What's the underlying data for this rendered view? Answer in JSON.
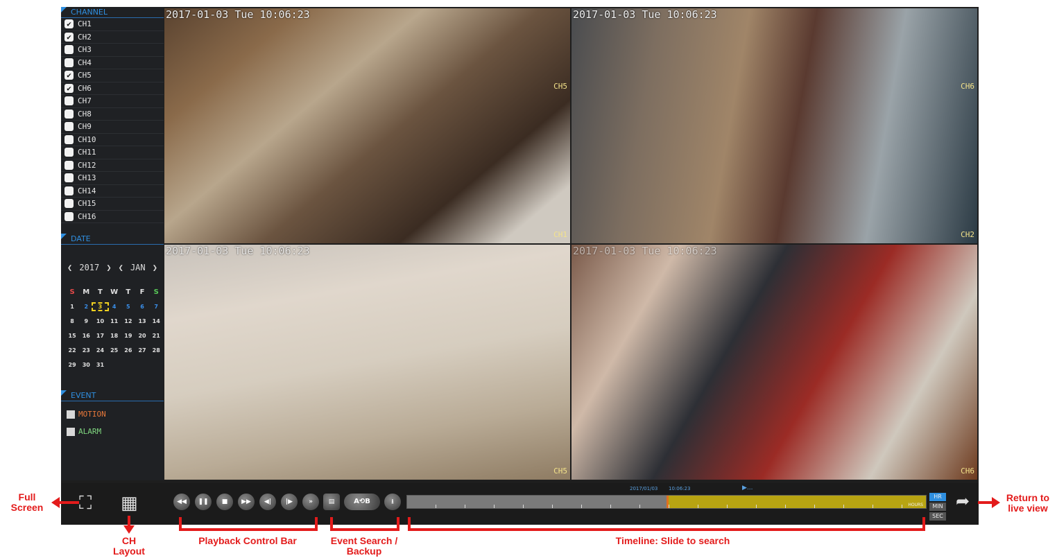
{
  "sidebar": {
    "channel_header": "CHANNEL",
    "channels": [
      {
        "label": "CH1",
        "checked": "✔"
      },
      {
        "label": "CH2",
        "checked": "✔"
      },
      {
        "label": "CH3",
        "checked": ""
      },
      {
        "label": "CH4",
        "checked": ""
      },
      {
        "label": "CH5",
        "checked": "✔"
      },
      {
        "label": "CH6",
        "checked": "✔"
      },
      {
        "label": "CH7",
        "checked": ""
      },
      {
        "label": "CH8",
        "checked": ""
      },
      {
        "label": "CH9",
        "checked": ""
      },
      {
        "label": "CH10",
        "checked": ""
      },
      {
        "label": "CH11",
        "checked": ""
      },
      {
        "label": "CH12",
        "checked": ""
      },
      {
        "label": "CH13",
        "checked": ""
      },
      {
        "label": "CH14",
        "checked": ""
      },
      {
        "label": "CH15",
        "checked": ""
      },
      {
        "label": "CH16",
        "checked": ""
      }
    ],
    "date_header": "DATE",
    "year": "2017",
    "month": "JAN",
    "prev_glyph": "❮",
    "next_glyph": "❯",
    "weekdays": [
      "S",
      "M",
      "T",
      "W",
      "T",
      "F",
      "S"
    ],
    "weeks": [
      [
        "1",
        "2",
        "3",
        "4",
        "5",
        "6",
        "7"
      ],
      [
        "8",
        "9",
        "10",
        "11",
        "12",
        "13",
        "14"
      ],
      [
        "15",
        "16",
        "17",
        "18",
        "19",
        "20",
        "21"
      ],
      [
        "22",
        "23",
        "24",
        "25",
        "26",
        "27",
        "28"
      ],
      [
        "29",
        "30",
        "31",
        "",
        "",
        "",
        ""
      ]
    ],
    "event_header": "EVENT",
    "events": [
      {
        "label": "MOTION",
        "color": "#e8783a"
      },
      {
        "label": "ALARM",
        "color": "#7fd67f"
      }
    ]
  },
  "cameras": [
    {
      "timestamp": "2017-01-03 Tue 10:06:23",
      "label": "CH1",
      "corner_label": "CH5"
    },
    {
      "timestamp": "2017-01-03 Tue 10:06:23",
      "label": "CH2",
      "corner_label": "CH6"
    },
    {
      "timestamp": "2017-01-03 Tue 10:06:23",
      "label": "CH5",
      "corner_label": ""
    },
    {
      "timestamp": "2017-01-03 Tue 10:06:23",
      "label": "CH6",
      "corner_label": ""
    }
  ],
  "toolbar": {
    "fullscreen_glyph": "⛶",
    "layout_glyph": "▦",
    "playback_buttons": [
      "◀◀",
      "❚❚",
      "■",
      "▶▶",
      "◀|",
      "|▶",
      "»"
    ],
    "event_search_glyph": "▤",
    "ab_label": "A⟲B",
    "backup_glyph": "⭳",
    "timeline_date": "2017/01/03",
    "timeline_time": "10:06:23",
    "timeline_marker": "▶...",
    "hours_label": "HOURS",
    "zoom_options": [
      "HR",
      "MIN",
      "SEC"
    ],
    "return_glyph": "➦",
    "timeline_fill_fraction": 0.5
  },
  "annotations": {
    "full_screen": "Full\nScreen",
    "ch_layout": "CH\nLayout",
    "playback_control_bar": "Playback Control Bar",
    "event_search_backup": "Event Search /\nBackup",
    "timeline": "Timeline: Slide to search",
    "return_live": "Return to\nlive view"
  },
  "colors": {
    "accent": "#2f8fe0",
    "annotation": "#e31b1b",
    "timeline_fill": "#b8a412",
    "osd_label": "#f4e38a"
  }
}
